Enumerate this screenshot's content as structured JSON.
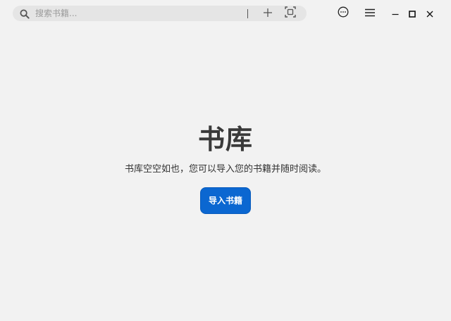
{
  "search": {
    "placeholder": "搜索书籍...",
    "icon": "search-icon"
  },
  "toolbar": {
    "add_icon": "plus-icon",
    "capture_icon": "screen-capture-icon",
    "more_icon": "more-icon",
    "menu_icon": "hamburger-menu-icon"
  },
  "window_controls": {
    "minimize_icon": "minimize-icon",
    "maximize_icon": "maximize-icon",
    "close_icon": "close-icon"
  },
  "library": {
    "title": "书库",
    "empty_message": "书库空空如也，您可以导入您的书籍并随时阅读。",
    "import_button": "导入书籍"
  },
  "colors": {
    "background": "#f2f2f2",
    "search_bg": "#e5e5e5",
    "accent": "#0b67d1"
  }
}
